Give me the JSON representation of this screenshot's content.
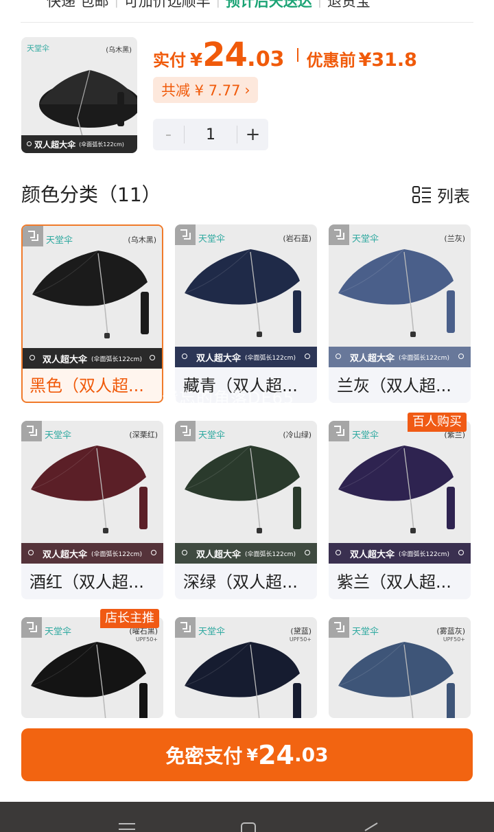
{
  "service_row": {
    "items": [
      "快递 包邮",
      "可加价选顺丰",
      "预计后天送达",
      "退货宝"
    ],
    "highlight_index": 2
  },
  "product": {
    "thumb_brand": "天堂伞",
    "thumb_color": "(乌木黑)",
    "thumb_band": "双人超大伞",
    "thumb_band_note": "(伞面弧长122cm)",
    "price_label": "实付",
    "currency": "¥",
    "price_int": "24",
    "price_dot": ".",
    "price_dec": "03",
    "pre_label": "优惠前",
    "pre_value": "¥31.8",
    "savings_label": "共减 ¥ 7.77",
    "quantity": "1",
    "minus": "-",
    "plus": "+"
  },
  "section": {
    "title": "颜色分类（11）",
    "toggle_label": "列表"
  },
  "brand": "天堂伞",
  "band_text": "双人超大伞",
  "band_note": "(伞面弧长122cm)",
  "variants": [
    {
      "caption": "黑色（双人超...",
      "color_tag": "(乌木黑)",
      "canopy": "#1b1b1b",
      "band": "#2a2a2a",
      "selected": true
    },
    {
      "caption": "藏青（双人超...",
      "color_tag": "(岩石蓝)",
      "canopy": "#1f2a48",
      "band": "#2c3656",
      "selected": false
    },
    {
      "caption": "兰灰（双人超...",
      "color_tag": "(兰灰)",
      "canopy": "#4a5f8a",
      "band": "#68789a",
      "selected": false
    },
    {
      "caption": "酒红（双人超...",
      "color_tag": "(深栗红)",
      "canopy": "#5b1f27",
      "band": "#55333a",
      "selected": false
    },
    {
      "caption": "深绿（双人超...",
      "color_tag": "(冷山绿)",
      "canopy": "#2a3a2c",
      "band": "#3f4a40",
      "selected": false
    },
    {
      "caption": "紫兰（双人超...",
      "color_tag": "(紫兰)",
      "canopy": "#2e2350",
      "band": "#3a3050",
      "selected": false,
      "tag": "百人购买"
    },
    {
      "color_tag": "(曜石黑)",
      "upf": "UPF50+",
      "canopy": "#141414",
      "selected": false,
      "tag": "店长主推"
    },
    {
      "color_tag": "(黛蓝)",
      "upf": "UPF50+",
      "canopy": "#161c30",
      "selected": false
    },
    {
      "color_tag": "(雾蓝灰)",
      "upf": "UPF50+",
      "canopy": "#3e5578",
      "selected": false
    }
  ],
  "watermark": "遗忘的角落DE65",
  "pay_button": {
    "label": "免密支付",
    "currency": "¥",
    "int": "24",
    "dec": ".03"
  },
  "colors": {
    "accent": "#f26411",
    "price": "#f05a0a",
    "delivery_green": "#1aa374",
    "nav_bg": "#3b3938"
  }
}
